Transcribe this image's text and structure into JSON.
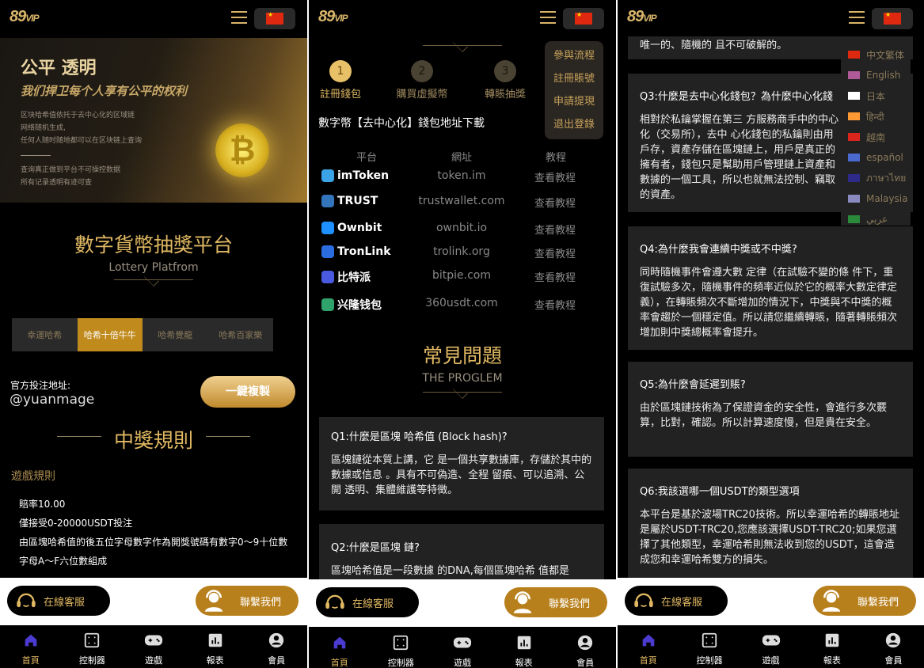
{
  "common": {
    "logo": "89",
    "logo_suffix": "VIP",
    "current_language_flag": "cn",
    "service_button": "在線客服",
    "contact_button": "聯繫我們",
    "bottom_nav": [
      {
        "label": "首頁",
        "icon": "home-icon",
        "active": true
      },
      {
        "label": "控制器",
        "icon": "controller-icon"
      },
      {
        "label": "遊戲",
        "icon": "gamepad-icon"
      },
      {
        "label": "報表",
        "icon": "chart-icon"
      },
      {
        "label": "會員",
        "icon": "user-icon"
      }
    ],
    "colors": {
      "gold": "#e0b862",
      "accent": "#c08a1c",
      "card": "#222222",
      "home_icon": "#4b3bd0"
    }
  },
  "home": {
    "banner": {
      "title": "公平 透明",
      "subtitle": "我们捍卫每个人享有公平的权利",
      "lines": [
        "区块哈希值依托于去中心化的区域链",
        "网络随机生成,",
        "任何人随时随地都可以在区块链上查询"
      ],
      "lines2": [
        "查询真正做到平台不可操控数据",
        "所有记录透明有迹可查"
      ]
    },
    "title": "數字貨幣抽獎平台",
    "subtitle": "Lottery Platfrom",
    "tabs": [
      {
        "label": "幸運哈希"
      },
      {
        "label": "哈希十倍牛牛",
        "active": true
      },
      {
        "label": "哈希覺龍"
      },
      {
        "label": "哈希百家樂"
      }
    ],
    "address_label": "官方投注地址:",
    "address_value": "@yuanmage",
    "copy_button": "一鍵複製",
    "rules_title": "中獎規則",
    "game_rules_label": "遊戲規則",
    "rules": [
      "賠率10.00",
      "僅接受0-20000USDT投注",
      "由區塊哈希值的後五位字母數字作為開獎號碼有數字0～9十位數",
      "字母A～F六位數組成"
    ]
  },
  "wallet": {
    "steps": [
      {
        "num": "1",
        "label": "註冊錢包",
        "active": true
      },
      {
        "num": "2",
        "label": "購買虛擬幣"
      },
      {
        "num": "3",
        "label": "轉賬抽獎"
      }
    ],
    "menu": [
      "參與流程",
      "註冊賬號",
      "申請提現",
      "退出登錄"
    ],
    "download_title": "數字幣【去中心化】錢包地址下載",
    "table_headers": [
      "平台",
      "網址",
      "教程"
    ],
    "rows": [
      {
        "platform": "imToken",
        "url": "token.im",
        "tutorial": "查看教程",
        "color": "#3ba4e6"
      },
      {
        "platform": "TRUST",
        "url": "trustwallet.com",
        "tutorial": "查看教程",
        "color": "#3375bb"
      },
      {
        "platform": "Ownbit",
        "url": "ownbit.io",
        "tutorial": "查看教程",
        "color": "#1e90ff"
      },
      {
        "platform": "TronLink",
        "url": "trolink.org",
        "tutorial": "查看教程",
        "color": "#2b6ce0"
      },
      {
        "platform": "比特派",
        "url": "bitpie.com",
        "tutorial": "查看教程",
        "color": "#4a5ae0"
      },
      {
        "platform": "兴隆钱包",
        "url": "360usdt.com",
        "tutorial": "查看教程",
        "color": "#2fa36b"
      }
    ],
    "faq_title": "常見問題",
    "faq_subtitle": "THE PROGLEM",
    "faqs": [
      {
        "q": "Q1:什麼是區塊 哈希值 (Block hash)?",
        "a": "區塊鏈從本質上講，它 是一個共享數據庫，存儲於其中的數據或信息 。具有不可偽造、全程 留痕、可以追溯、公開 透明、集體維護等特徵。"
      },
      {
        "q": "Q2:什麼是區塊 鏈?",
        "a": "區塊哈希值是一段數據 的DNA,每個區塊哈希 值都是"
      }
    ]
  },
  "faq": {
    "prev_tail": "唯一的、隨機的 且不可破解的。",
    "faqs": [
      {
        "q": "Q3:什麼是去中心化錢包？為什麼中心化錢",
        "a": "相對於私鑰掌握在第三 方服務商手中的中心化（交易所），去中 心化錢包的私鑰則由用戶存，資產存儲在區塊鏈上，用戶是真正的擁有者，錢包只是幫助用戶管理鏈上資產和數據的一個工具，所以也就無法控制、竊取的資產。"
      },
      {
        "q": "Q4:為什麼我會連續中獎或不中獎?",
        "a": "同時隨機事件會遵大數 定律（在試驗不變的條 件下，重復試驗多次，隨機事件的頻率近似於它的概率大數定律定義），在轉賬頻次不斷增加的情況下，中獎與不中獎的概率會趨於一個穩定值。所以請您繼續轉賬，隨著轉賬頻次增加則中獎總概率會提升。"
      },
      {
        "q": "Q5:為什麼會延遲到賬?",
        "a": "由於區塊鏈技術為了保證資金的安全性，會進行多次覈算，比對，確認。所以計算速度慢，但是貴在安全。"
      },
      {
        "q": "Q6:我該選哪一個USDT的類型選項",
        "a": "本平台是基於波場TRC20技術。所以幸運哈希的轉賬地址是屬於USDT-TRC20,您應該選擇USDT-TRC20;如果您選擇了其他類型，幸運哈希則無法收到您的USDT，這會造成您和幸運哈希雙方的損失。"
      }
    ],
    "languages": [
      {
        "label": "中文繁体",
        "flag": "#de2910"
      },
      {
        "label": "English",
        "flag": "#b05a9a"
      },
      {
        "label": "日本",
        "flag": "#ffffff"
      },
      {
        "label": "हिन्दी",
        "flag": "#ff9933"
      },
      {
        "label": "越南",
        "flag": "#da251d"
      },
      {
        "label": "español",
        "flag": "#4a6ad0"
      },
      {
        "label": "ภาษาไทย",
        "flag": "#2d2a8a"
      },
      {
        "label": "Malaysia",
        "flag": "#8a8ac0"
      },
      {
        "label": "عربي",
        "flag": "#2a8a3a"
      }
    ]
  }
}
